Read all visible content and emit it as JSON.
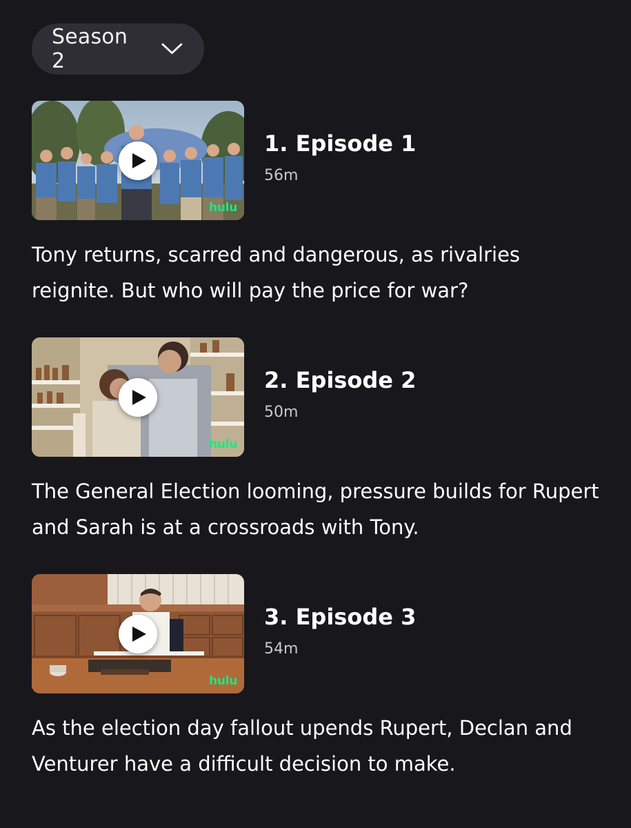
{
  "season_selector": {
    "label": "Season 2",
    "icon": "chevron-down-icon"
  },
  "episodes": [
    {
      "title": "1. Episode 1",
      "duration": "56m",
      "description": "Tony returns, scarred and dangerous, as rivalries reignite. But who will pay the price for war?",
      "badge": "hulu"
    },
    {
      "title": "2. Episode 2",
      "duration": "50m",
      "description": "The General Election looming, pressure builds for Rupert and Sarah is at a crossroads with Tony.",
      "badge": "hulu"
    },
    {
      "title": "3. Episode 3",
      "duration": "54m",
      "description": "As the election day fallout upends Rupert, Declan and Venturer have a difficult decision to make.",
      "badge": "hulu"
    }
  ],
  "colors": {
    "background": "#18171c",
    "selector_bg": "#2f2e34",
    "hulu_green": "#1ce783"
  }
}
